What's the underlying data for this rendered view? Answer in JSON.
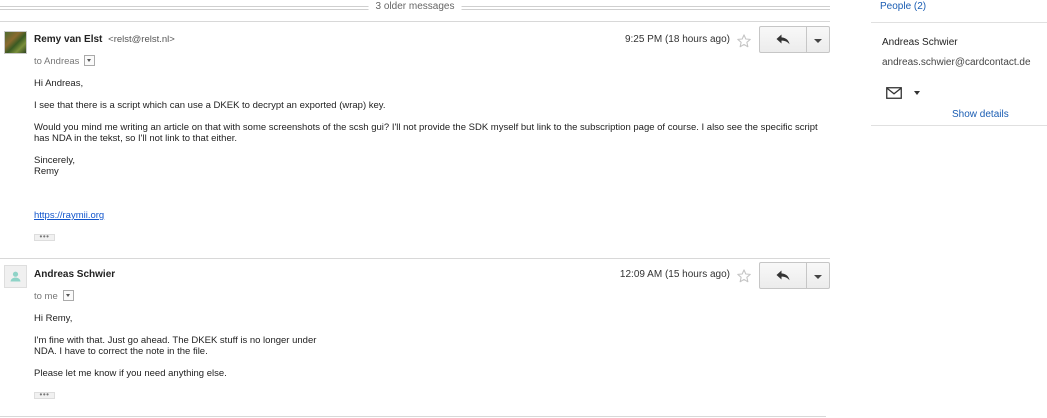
{
  "thread": {
    "older_messages_label": "3 older messages"
  },
  "messages": [
    {
      "sender_name": "Remy van Elst",
      "sender_email": "<relst@relst.nl>",
      "to": "to Andreas",
      "time": "9:25 PM (18 hours ago)",
      "body": [
        "Hi Andreas,",
        "I see that there is a script which can use a DKEK to decrypt an exported (wrap) key.",
        "Would you mind me writing an article on that with some screenshots of the scsh gui? I'll not provide the SDK myself but link to the subscription page of course. I also see the specific script has NDA in the tekst, so I'll not link to that either.",
        "Sincerely,",
        "Remy"
      ],
      "link": "https://raymii.org",
      "ellipsis": "•••"
    },
    {
      "sender_name": "Andreas Schwier",
      "to": "to me",
      "time": "12:09 AM (15 hours ago)",
      "body": [
        "Hi Remy,",
        "I'm fine with that. Just go ahead. The DKEK stuff is no longer under",
        "NDA. I have to correct the note in the file.",
        "Please let me know if you need anything else."
      ],
      "ellipsis": "•••"
    }
  ],
  "sidebar": {
    "people_label": "People (2)",
    "contact_name": "Andreas Schwier",
    "contact_email": "andreas.schwier@cardcontact.de",
    "show_details": "Show details"
  },
  "icons": {
    "star": "star-outline-icon",
    "reply": "reply-arrow-icon",
    "more": "chevron-down-icon",
    "mail": "envelope-icon",
    "avatar_generic": "person-icon"
  },
  "colors": {
    "link": "#1155cc",
    "accent": "#1a5db3"
  }
}
